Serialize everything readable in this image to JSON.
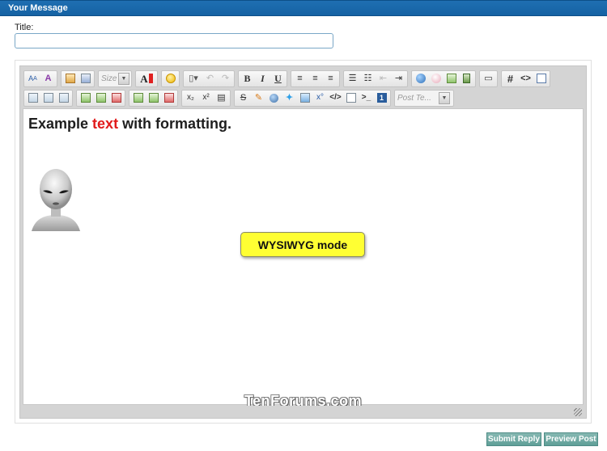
{
  "section_title": "Your Message",
  "title_field": {
    "label": "Title:",
    "value": ""
  },
  "toolbar": {
    "size_placeholder": "Size",
    "post_placeholder": "Post Te...",
    "bold": "B",
    "italic": "I",
    "underline": "U",
    "subscript": "x₂",
    "superscript": "x²",
    "strike": "S",
    "hash": "#",
    "code": "<>",
    "php": "</>",
    "cmd": ">_",
    "font_color_letter": "A",
    "number_one": "1",
    "font_family": "A",
    "font_face": "A",
    "x_degree": "x°"
  },
  "content": {
    "heading_before": "Example ",
    "heading_red": "text",
    "heading_after": " with formatting.",
    "callout": "WYSIWYG mode",
    "watermark": "TenForums.com"
  },
  "buttons": {
    "submit": "Submit Reply",
    "preview": "Preview Post"
  },
  "colors": {
    "header": "#1562a3",
    "red_text": "#e11b1b",
    "callout_bg": "#ffff33",
    "button": "#6aa6a0"
  }
}
